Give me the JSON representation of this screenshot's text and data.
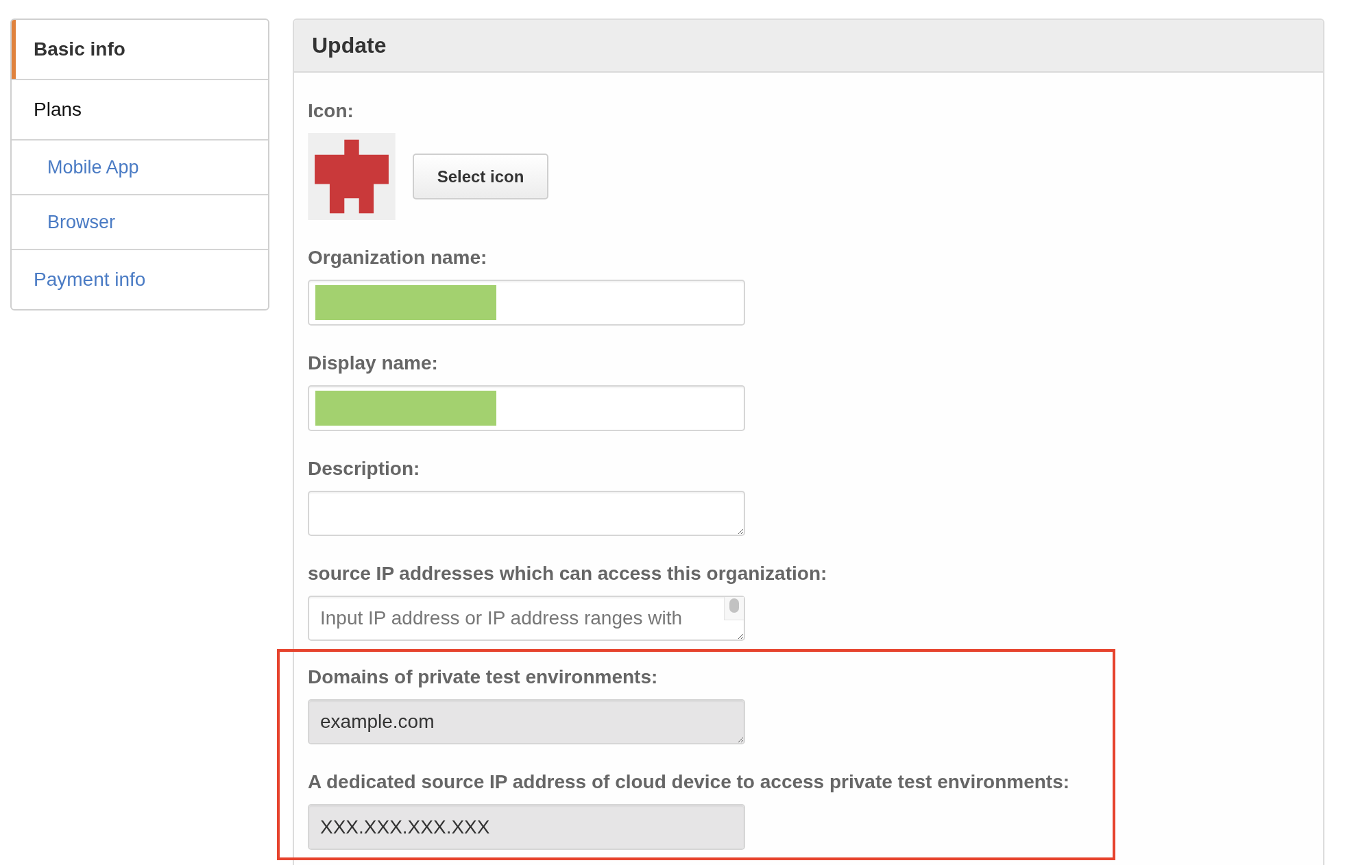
{
  "sidebar": {
    "items": [
      {
        "label": "Basic info",
        "selected": true
      },
      {
        "label": "Plans",
        "selected": false,
        "children": [
          {
            "label": "Mobile App",
            "selected": false
          },
          {
            "label": "Browser",
            "selected": false
          }
        ]
      },
      {
        "label": "Payment info",
        "selected": false
      }
    ]
  },
  "panel": {
    "title": "Update",
    "fields": [
      {
        "kind": "icon",
        "label": "Icon:",
        "button": "Select icon",
        "highlighted": false
      },
      {
        "kind": "text",
        "label": "Organization name:",
        "readonly": false,
        "redacted": true,
        "highlighted": false
      },
      {
        "kind": "text",
        "label": "Display name:",
        "readonly": false,
        "redacted": true,
        "highlighted": false
      },
      {
        "kind": "textarea",
        "label": "Description:",
        "readonly": false,
        "redacted": false,
        "scrollbar": false,
        "highlighted": false
      },
      {
        "kind": "textarea",
        "label": "source IP addresses which can access this organization:",
        "placeholder": "Input IP address or IP address ranges with",
        "readonly": false,
        "redacted": false,
        "scrollbar": true,
        "highlighted": false
      },
      {
        "kind": "textarea",
        "label": "Domains of private test environments:",
        "value": "example.com",
        "readonly": true,
        "redacted": false,
        "scrollbar": false,
        "highlighted": true
      },
      {
        "kind": "text",
        "label": "A dedicated source IP address of cloud device to access private test environments:",
        "value": "XXX.XXX.XXX.XXX",
        "readonly": true,
        "redacted": false,
        "highlighted": true
      }
    ]
  }
}
